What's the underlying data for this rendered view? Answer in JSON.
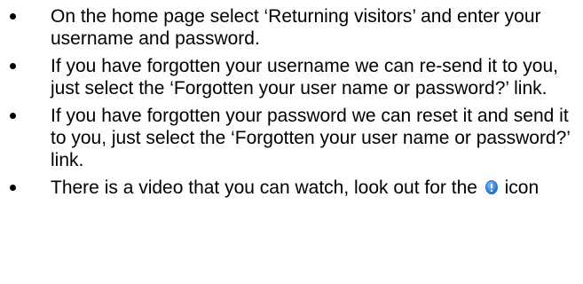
{
  "instructions": {
    "items": [
      {
        "text": "On the home page select ‘Returning visitors’ and enter your username and password."
      },
      {
        "text": "If you have forgotten your username we can re-send it to you, just select the ‘Forgotten your user name or password?’ link."
      },
      {
        "text": "If you have forgotten your password we can reset it and send it to you, just select the ‘Forgotten your user name or password?’ link."
      },
      {
        "text_before_icon": "There is a video that you can watch, look out for the",
        "icon": "video-info-icon",
        "text_after_icon": "icon"
      }
    ],
    "icon_color": "#2e7fd6"
  }
}
